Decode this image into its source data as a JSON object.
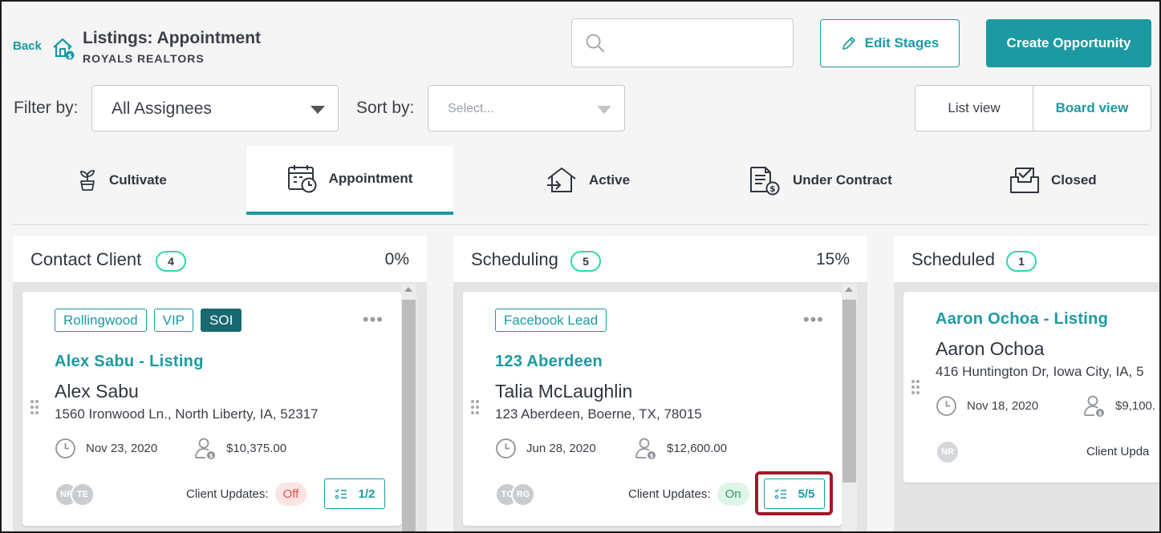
{
  "header": {
    "back_label": "Back",
    "title": "Listings: Appointment",
    "subtitle": "ROYALS REALTORS",
    "search": {
      "placeholder": ""
    },
    "edit_stages_label": "Edit Stages",
    "create_label": "Create Opportunity"
  },
  "filters": {
    "filter_label": "Filter by:",
    "filter_value": "All Assignees",
    "sort_label": "Sort by:",
    "sort_placeholder": "Select...",
    "list_view_label": "List view",
    "board_view_label": "Board view",
    "active_view": "Board view"
  },
  "stages": [
    {
      "label": "Cultivate",
      "icon": "sprout-icon"
    },
    {
      "label": "Appointment",
      "icon": "calendar-clock-icon",
      "active": true
    },
    {
      "label": "Active",
      "icon": "house-arrow-icon"
    },
    {
      "label": "Under Contract",
      "icon": "contract-dollar-icon"
    },
    {
      "label": "Closed",
      "icon": "inbox-check-icon"
    }
  ],
  "columns": [
    {
      "name": "Contact Client",
      "count": "4",
      "percent": "0%",
      "card": {
        "tags": [
          "Rollingwood",
          "VIP",
          "SOI"
        ],
        "title": "Alex Sabu - Listing",
        "name": "Alex Sabu",
        "address": "1560 Ironwood Ln., North Liberty, IA, 52317",
        "date": "Nov 23, 2020",
        "amount": "$10,375.00",
        "avatars": [
          "NR",
          "TE"
        ],
        "client_updates_label": "Client Updates:",
        "client_updates": "Off",
        "tasks": "1/2"
      }
    },
    {
      "name": "Scheduling",
      "count": "5",
      "percent": "15%",
      "card": {
        "tags": [
          "Facebook Lead"
        ],
        "title": "123 Aberdeen",
        "name": "Talia McLaughlin",
        "address": "123 Aberdeen, Boerne, TX, 78015",
        "date": "Jun 28, 2020",
        "amount": "$12,600.00",
        "avatars": [
          "TC",
          "RG"
        ],
        "client_updates_label": "Client Updates:",
        "client_updates": "On",
        "tasks": "5/5"
      }
    },
    {
      "name": "Scheduled",
      "count": "1",
      "card": {
        "title": "Aaron Ochoa - Listing",
        "name": "Aaron Ochoa",
        "address": "416 Huntington Dr, Iowa City, IA, 5",
        "date": "Nov 18, 2020",
        "amount": "$9,100.",
        "avatars": [
          "NR"
        ],
        "client_updates_label": "Client Upda"
      }
    }
  ],
  "colors": {
    "accent": "#1b9aa2",
    "count_border": "#2ed8a8",
    "highlight": "#a3182b"
  }
}
